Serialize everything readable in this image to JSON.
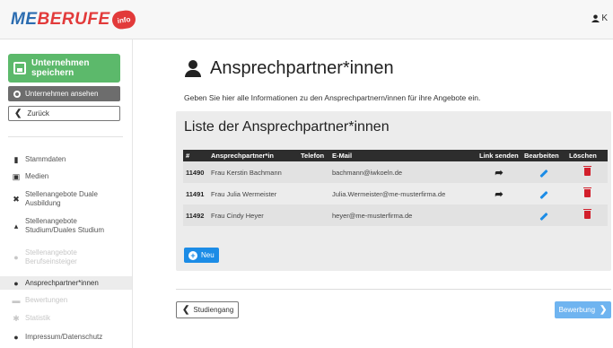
{
  "header": {
    "logo_text_me": "ME",
    "logo_text_berufe": "BERUFE",
    "logo_badge": "info",
    "user_initial": "K"
  },
  "sidebar": {
    "save_label": "Unternehmen speichern",
    "view_label": "Unternehmen ansehen",
    "back_label": "Zurück",
    "items": [
      {
        "label": "Stammdaten",
        "icon": "building-icon",
        "state": "normal"
      },
      {
        "label": "Medien",
        "icon": "images-icon",
        "state": "normal"
      },
      {
        "label": "Stellenangebote Duale Ausbildung",
        "icon": "tools-icon",
        "state": "normal"
      },
      {
        "label": "Stellenangebote Studium/Duales Studium",
        "icon": "graduation-icon",
        "state": "normal"
      },
      {
        "label": "Stellenangebote Berufseinsteiger",
        "icon": "users-icon",
        "state": "dim"
      },
      {
        "label": "Ansprechpartner*innen",
        "icon": "person-icon",
        "state": "active"
      },
      {
        "label": "Bewertungen",
        "icon": "comment-icon",
        "state": "dim"
      },
      {
        "label": "Statistik",
        "icon": "chart-icon",
        "state": "dim"
      },
      {
        "label": "Impressum/Datenschutz",
        "icon": "info-icon",
        "state": "normal"
      }
    ]
  },
  "main": {
    "title": "Ansprechpartner*innen",
    "intro": "Geben Sie hier alle Informationen zu den Ansprechpartnern/innen für ihre Angebote ein.",
    "card_title": "Liste der Ansprechpartner*innen",
    "table": {
      "headers": [
        "#",
        "Ansprechpartner*in",
        "Telefon",
        "E-Mail",
        "Link senden",
        "Bearbeiten",
        "Löschen"
      ],
      "rows": [
        {
          "id": "11490",
          "name": "Frau Kerstin Bachmann",
          "phone": "",
          "email": "bachmann@iwkoeln.de",
          "can_send": true
        },
        {
          "id": "11491",
          "name": "Frau Julia Wermeister",
          "phone": "",
          "email": "Julia.Wermeister@me-musterfirma.de",
          "can_send": true
        },
        {
          "id": "11492",
          "name": "Frau Cindy Heyer",
          "phone": "",
          "email": "heyer@me-musterfirma.de",
          "can_send": false
        }
      ]
    },
    "new_label": "Neu",
    "prev_label": "Studiengang",
    "next_label": "Bewerbung"
  },
  "colors": {
    "accent_green": "#5cb96b",
    "accent_blue": "#1c8ce6",
    "delete_red": "#d21f2b",
    "table_header": "#2d2d2d"
  }
}
